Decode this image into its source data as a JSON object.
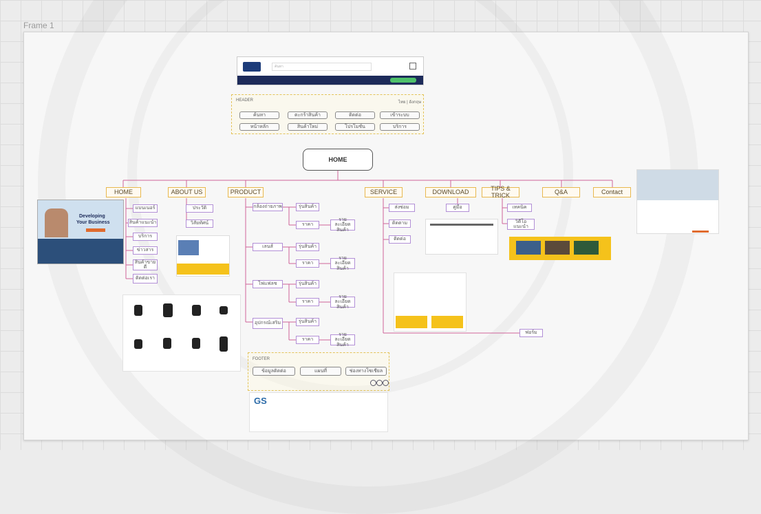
{
  "frame_label": "Frame 1",
  "header_mock": {
    "search_placeholder": "ค้นหา"
  },
  "header_section": {
    "label": "HEADER",
    "lang": "ไทย | อังกฤษ",
    "buttons": [
      "ค้นหา",
      "ตะกร้าสินค้า",
      "ติดต่อ",
      "เข้าระบบ",
      "หน้าหลัก",
      "สินค้าใหม่",
      "โปรโมชั่น",
      "บริการ"
    ]
  },
  "home_label": "HOME",
  "nav": {
    "items": [
      "HOME",
      "ABOUT US",
      "PRODUCT",
      "SERVICE",
      "DOWNLOAD",
      "TIPS & TRICK",
      "Q&A",
      "Contact"
    ]
  },
  "home_sub": [
    "แบนเนอร์",
    "สินค้าแนะนำ",
    "บริการ",
    "ข่าวสาร",
    "สินค้าขายดี",
    "ติดต่อเรา"
  ],
  "about_sub": [
    "ประวัติ",
    "วิสัยทัศน์"
  ],
  "product_groups": [
    {
      "cat": "กล้องถ่ายภาพ",
      "sub": "รุ่นสินค้า",
      "detail": "ราคา",
      "note": "รายละเอียดสินค้า"
    },
    {
      "cat": "เลนส์",
      "sub": "รุ่นสินค้า",
      "detail": "ราคา",
      "note": "รายละเอียดสินค้า"
    },
    {
      "cat": "ไฟแฟลช",
      "sub": "รุ่นสินค้า",
      "detail": "ราคา",
      "note": "รายละเอียดสินค้า"
    },
    {
      "cat": "อุปกรณ์เสริม",
      "sub": "รุ่นสินค้า",
      "detail": "ราคา",
      "note": "รายละเอียดสินค้า"
    }
  ],
  "service_sub": [
    "ส่งซ่อม",
    "ติดตาม",
    "ติดต่อ"
  ],
  "service_bottom": "ฟอร์ม",
  "download_sub": "คู่มือ",
  "tips_sub": [
    "เทคนิค",
    "วิดีโอแนะนำ"
  ],
  "footer_section": {
    "label": "FOOTER",
    "buttons": [
      "ข้อมูลติดต่อ",
      "แผนที่",
      "ช่องทางโซเชียล"
    ]
  },
  "footer_mock": {
    "logo": "GS"
  },
  "hero_mock": {
    "title_line1": "Developing",
    "title_line2": "Your Business"
  },
  "colors": {
    "accent": "#c94a8a",
    "frame": "#f7f7f7",
    "nav_border": "#e8b84e",
    "sub_border": "#b28fd6"
  }
}
